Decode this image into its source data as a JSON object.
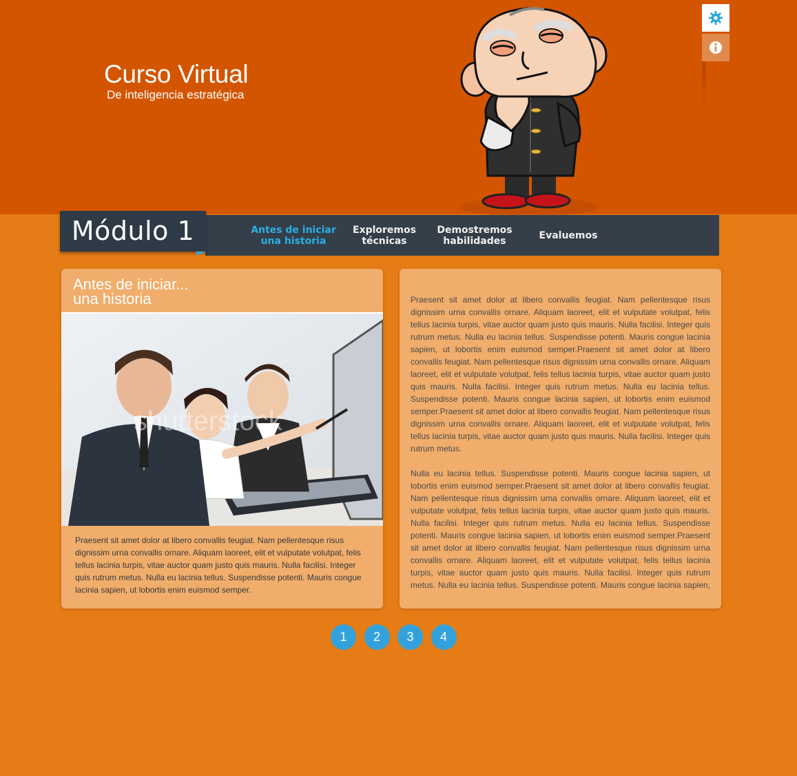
{
  "brand": {
    "title": "Curso Virtual",
    "subtitle": "De inteligencia estratégica"
  },
  "mascot_icon": "thinking-old-man-mascot",
  "tools": [
    {
      "icon": "gear-icon",
      "color": "#2ea6dc"
    },
    {
      "icon": "info-icon",
      "color": "#ffffff"
    }
  ],
  "module": {
    "label": "Módulo 1"
  },
  "nav": [
    {
      "line1": "Antes de iniciar",
      "line2": "una historia",
      "active": true
    },
    {
      "line1": "Exploremos",
      "line2": "técnicas",
      "active": false
    },
    {
      "line1": "Demostremos",
      "line2": "habilidades",
      "active": false
    },
    {
      "line1": "Evaluemos",
      "line2": "",
      "active": false
    }
  ],
  "left_panel": {
    "title_line1": "Antes de iniciar...",
    "title_line2": "una historia",
    "photo_watermark": "shutterstock",
    "body": "Praesent sit amet dolor at libero convallis feugiat. Nam pellentesque risus dignissim urna convallis ornare. Aliquam laoreet, elit et vulputate volutpat, felis tellus lacinia turpis, vitae auctor quam justo quis mauris. Nulla facilisi. Integer quis rutrum metus. Nulla eu lacinia tellus. Suspendisse potenti. Mauris congue lacinia sapien, ut lobortis enim euismod semper."
  },
  "right_panel": {
    "paragraph1": "Praesent sit amet dolor at libero convallis feugiat. Nam pellentesque risus dignissim urna convallis ornare. Aliquam laoreet, elit et vulputate volutpat, felis tellus lacinia turpis, vitae auctor quam justo quis mauris. Nulla facilisi. Integer quis rutrum metus. Nulla eu lacinia tellus. Suspendisse potenti. Mauris congue lacinia sapien, ut lobortis enim euismod semper.Praesent sit amet dolor at libero convallis feugiat. Nam pellentesque risus dignissim urna convallis ornare. Aliquam laoreet, elit et vulputate volutpat, felis tellus lacinia turpis, vitae auctor quam justo quis mauris. Nulla facilisi. Integer quis rutrum metus. Nulla eu lacinia tellus. Suspendisse potenti. Mauris congue lacinia sapien, ut lobortis enim euismod semper.Praesent sit amet dolor at libero convallis feugiat. Nam pellentesque risus dignissim urna convallis ornare. Aliquam laoreet, elit et vulputate volutpat, felis tellus lacinia turpis, vitae auctor quam justo quis mauris. Nulla facilisi. Integer quis rutrum metus.",
    "paragraph2": "Nulla eu lacinia tellus. Suspendisse potenti. Mauris congue lacinia sapien, ut lobortis enim euismod semper.Praesent sit amet dolor at libero convallis feugiat. Nam pellentesque risus dignissim urna convallis ornare. Aliquam laoreet, elit et vulputate volutpat, felis tellus lacinia turpis, vitae auctor quam justo quis mauris. Nulla facilisi. Integer quis rutrum metus. Nulla eu lacinia tellus. Suspendisse potenti. Mauris congue lacinia sapien, ut lobortis enim euismod semper.Praesent sit amet dolor at libero convallis feugiat. Nam pellentesque risus dignissim urna convallis ornare. Aliquam laoreet, elit et vulputate volutpat, felis tellus lacinia turpis, vitae auctor quam justo quis mauris. Nulla facilisi. Integer quis rutrum metus. Nulla eu lacinia tellus. Suspendisse potenti. Mauris congue lacinia sapien, ut lobortis"
  },
  "pager": [
    "1",
    "2",
    "3",
    "4"
  ],
  "colors": {
    "header": "#d45500",
    "page_background": "#e57c16",
    "panel": "#f0ad6b",
    "nav_background": "#323c47",
    "accent_blue": "#33a2dc"
  }
}
